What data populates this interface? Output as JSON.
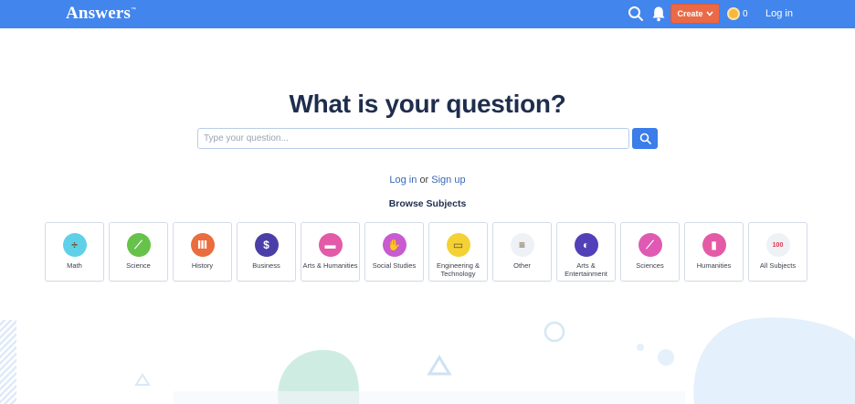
{
  "header": {
    "logo": "Answers",
    "logo_tm": "™",
    "create_label": "Create",
    "coin_count": "0",
    "login_label": "Log in"
  },
  "hero": {
    "title": "What is your question?",
    "search_placeholder": "Type your question...",
    "login_link": "Log in",
    "or_text": "or",
    "signup_link": "Sign up",
    "browse_label": "Browse Subjects"
  },
  "subjects": [
    {
      "label": "Math",
      "icon": "divide-icon",
      "glyph": "÷",
      "color": "#5fd0e8"
    },
    {
      "label": "Science",
      "icon": "test-tube-icon",
      "glyph": "⟋",
      "color": "#66c24a"
    },
    {
      "label": "History",
      "icon": "columns-icon",
      "glyph": "Ⅲ",
      "color": "#ea6d3f"
    },
    {
      "label": "Business",
      "icon": "money-bag-icon",
      "glyph": "$",
      "color": "#4a3fa8"
    },
    {
      "label": "Arts & Humanities",
      "icon": "theater-icon",
      "glyph": "▬",
      "color": "#e25aa8"
    },
    {
      "label": "Social Studies",
      "icon": "handshake-icon",
      "glyph": "✋",
      "color": "#c95ad0"
    },
    {
      "label": "Engineering & Technology",
      "icon": "monitor-icon",
      "glyph": "▭",
      "color": "#f4d234"
    },
    {
      "label": "Other",
      "icon": "books-icon",
      "glyph": "≡",
      "color": "#eef1f6"
    },
    {
      "label": "Arts & Entertainment",
      "icon": "theater-mask-icon",
      "glyph": "◐",
      "color": "#5140b8"
    },
    {
      "label": "Sciences",
      "icon": "test-tube-icon",
      "glyph": "⟋",
      "color": "#e05ab4"
    },
    {
      "label": "Humanities",
      "icon": "jar-icon",
      "glyph": "▮",
      "color": "#e55aa6"
    },
    {
      "label": "All Subjects",
      "icon": "hundred-icon",
      "glyph": "100",
      "color": "#eef1f6"
    }
  ],
  "colors": {
    "header_bg": "#4285ed",
    "create_bg": "#ea6a47",
    "link": "#3668b8"
  }
}
